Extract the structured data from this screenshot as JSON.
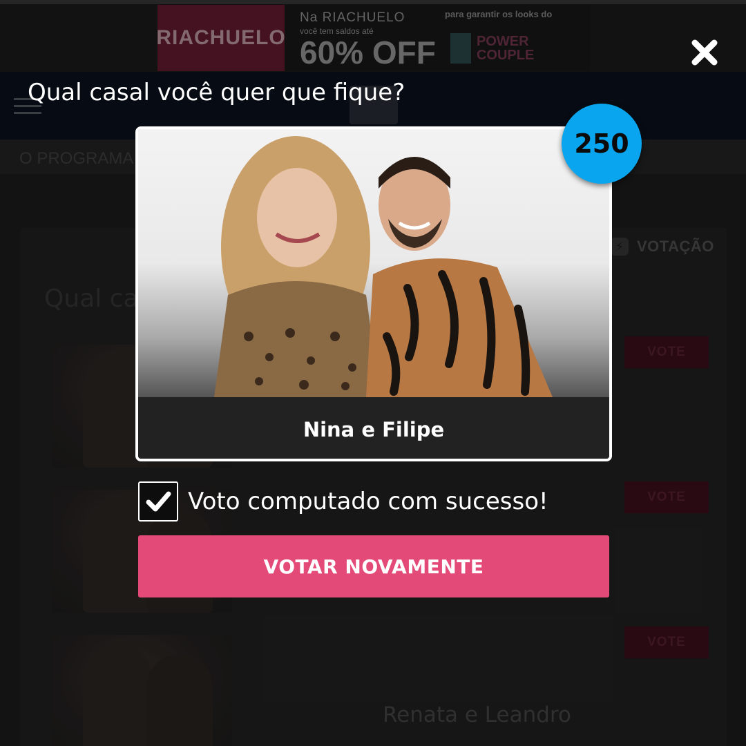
{
  "ad": {
    "brand": "RIACHUELO",
    "line1": "Na RIACHUELO",
    "line2": "você tem saldos até",
    "offer": "60% OFF",
    "tagline": "para garantir os looks do",
    "show": "POWER COUPLE"
  },
  "header": {
    "nav_text": "O PROGRAMA",
    "votacao_label": "VOTAÇÃO"
  },
  "page": {
    "heading": "Qual ca",
    "rows": [
      {
        "vote_label": "VOTE",
        "name": ""
      },
      {
        "vote_label": "VOTE",
        "name": ""
      },
      {
        "vote_label": "VOTE",
        "name": "Renata e Leandro"
      }
    ]
  },
  "modal": {
    "title": "Qual casal você quer que fique?",
    "couple_name": "Nina e Filipe",
    "vote_count": "250",
    "success_message": "Voto computado com sucesso!",
    "vote_again_label": "VOTAR NOVAMENTE",
    "close_icon": "close-icon"
  },
  "colors": {
    "accent_pink": "#e34a78",
    "badge_blue": "#0aa5ef",
    "header_navy": "#0c1320"
  }
}
